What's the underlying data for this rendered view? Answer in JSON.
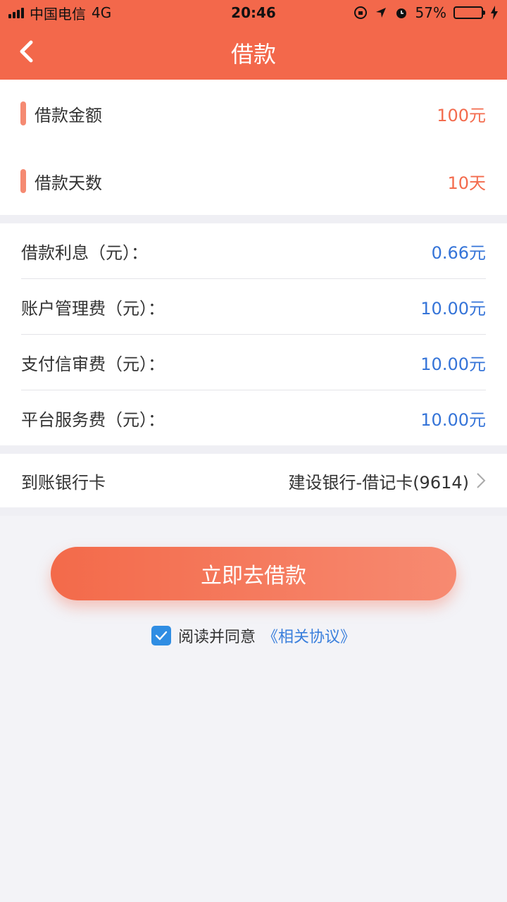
{
  "status_bar": {
    "carrier": "中国电信",
    "network": "4G",
    "time": "20:46",
    "battery_percent": "57%",
    "battery_level": 0.57
  },
  "header": {
    "title": "借款",
    "back_icon": "back-chevron-icon"
  },
  "loan": {
    "amount_label": "借款金额",
    "amount_value": "100元",
    "days_label": "借款天数",
    "days_value": "10天"
  },
  "fees": [
    {
      "label": "借款利息（元）：",
      "value": "0.66元"
    },
    {
      "label": "账户管理费（元）：",
      "value": "10.00元"
    },
    {
      "label": "支付信审费（元）：",
      "value": "10.00元"
    },
    {
      "label": "平台服务费（元）：",
      "value": "10.00元"
    }
  ],
  "bank": {
    "label": "到账银行卡",
    "value": "建设银行-借记卡(9614)"
  },
  "action": {
    "submit_label": "立即去借款"
  },
  "agreement": {
    "checked": true,
    "text": "阅读并同意",
    "link": "《相关协议》"
  },
  "colors": {
    "brand": "#f3684b",
    "value_orange": "#f36b4d",
    "value_blue": "#3574d8",
    "checkbox": "#2f8de3"
  }
}
